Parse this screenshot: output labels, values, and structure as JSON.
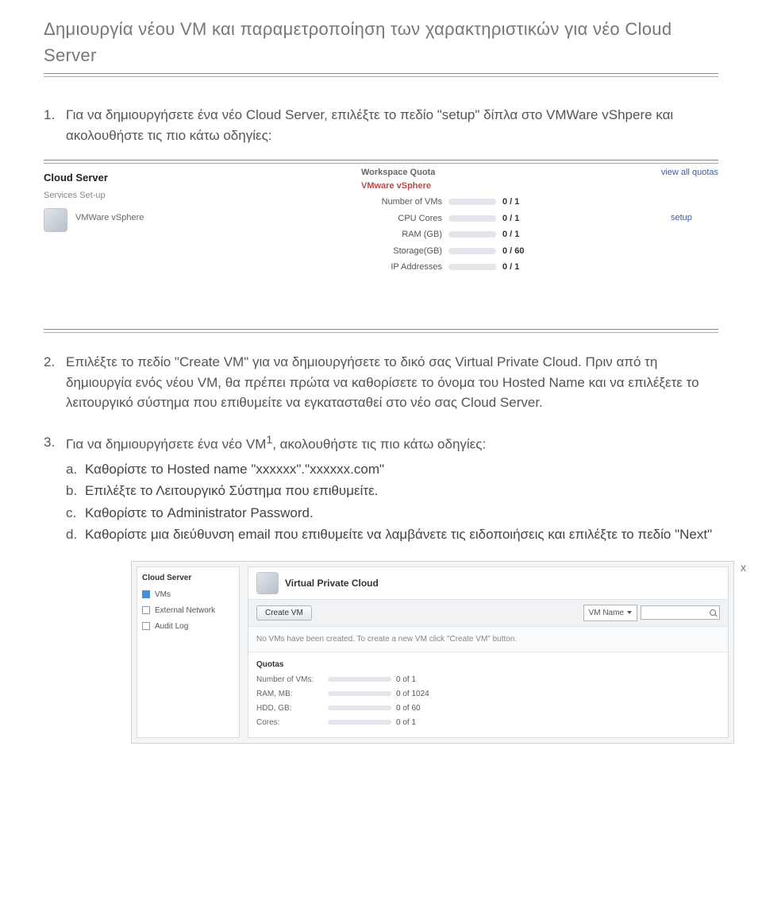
{
  "title": "Δημιουργία νέου VM και παραμετροποίηση των χαρακτηριστικών για νέο Cloud Server",
  "step1": {
    "num": "1.",
    "text": "Για να δημιουργήσετε ένα νέο Cloud Server, επιλέξτε το πεδίο \"setup\" δίπλα στο VMWare vShpere και ακολουθήστε τις πιο κάτω οδηγίες:"
  },
  "shot1": {
    "block_title": "Cloud Server",
    "services_setup": "Services Set-up",
    "service_name": "VMWare vSphere",
    "setup_link": "setup",
    "viewall": "view all quotas",
    "workspace_quota": "Workspace Quota",
    "vmware_vsphere": "VMware vSphere",
    "rows": [
      {
        "label": "Number of VMs",
        "val": "0 / 1"
      },
      {
        "label": "CPU Cores",
        "val": "0 / 1"
      },
      {
        "label": "RAM (GB)",
        "val": "0 / 1"
      },
      {
        "label": "Storage(GB)",
        "val": "0 / 60"
      },
      {
        "label": "IP Addresses",
        "val": "0 / 1"
      }
    ]
  },
  "step2": {
    "num": "2.",
    "text": "Επιλέξτε το πεδίο \"Create VM\" για να δημιουργήσετε το δικό σας Virtual Private Cloud. Πριν από τη δημιουργία ενός νέου VM, θα πρέπει πρώτα να καθορίσετε το όνομα του Hosted Name και να επιλέξετε το λειτουργικό σύστημα  που επιθυμείτε να εγκατασταθεί στο νέο σας Cloud Server."
  },
  "step3": {
    "num": "3.",
    "intro_a": "Για να δημιουργήσετε ένα νέο VM",
    "sup": "1",
    "intro_b": ", ακολουθήστε τις πιο κάτω οδηγίες:",
    "subs": [
      {
        "letter": "a.",
        "text": "Καθορίστε το Hosted name \"xxxxxx\".\"xxxxxx.com\""
      },
      {
        "letter": "b.",
        "text": "Επιλέξτε το Λειτουργικό Σύστημα που επιθυμείτε."
      },
      {
        "letter": "c.",
        "text": "Καθορίστε το Administrator Password."
      },
      {
        "letter": "d.",
        "text": "Καθορίστε μια διεύθυνση email που επιθυμείτε να λαμβάνετε τις ειδοποιήσεις και επιλέξτε το πεδίο \"Next\""
      }
    ]
  },
  "shot2": {
    "close": "x",
    "cloud_server": "Cloud Server",
    "side": [
      {
        "label": "VMs",
        "checked": true
      },
      {
        "label": "External Network",
        "checked": false
      },
      {
        "label": "Audit Log",
        "checked": false
      }
    ],
    "main_title": "Virtual Private Cloud",
    "create_btn": "Create VM",
    "dropdown": "VM Name",
    "empty_msg": "No VMs have been created. To create a new VM click \"Create VM\" button.",
    "quotas_title": "Quotas",
    "quotas": [
      {
        "label": "Number of VMs:",
        "val": "0 of 1"
      },
      {
        "label": "RAM, MB:",
        "val": "0 of 1024"
      },
      {
        "label": "HDD, GB:",
        "val": "0 of 60"
      },
      {
        "label": "Cores:",
        "val": "0 of 1"
      }
    ]
  }
}
